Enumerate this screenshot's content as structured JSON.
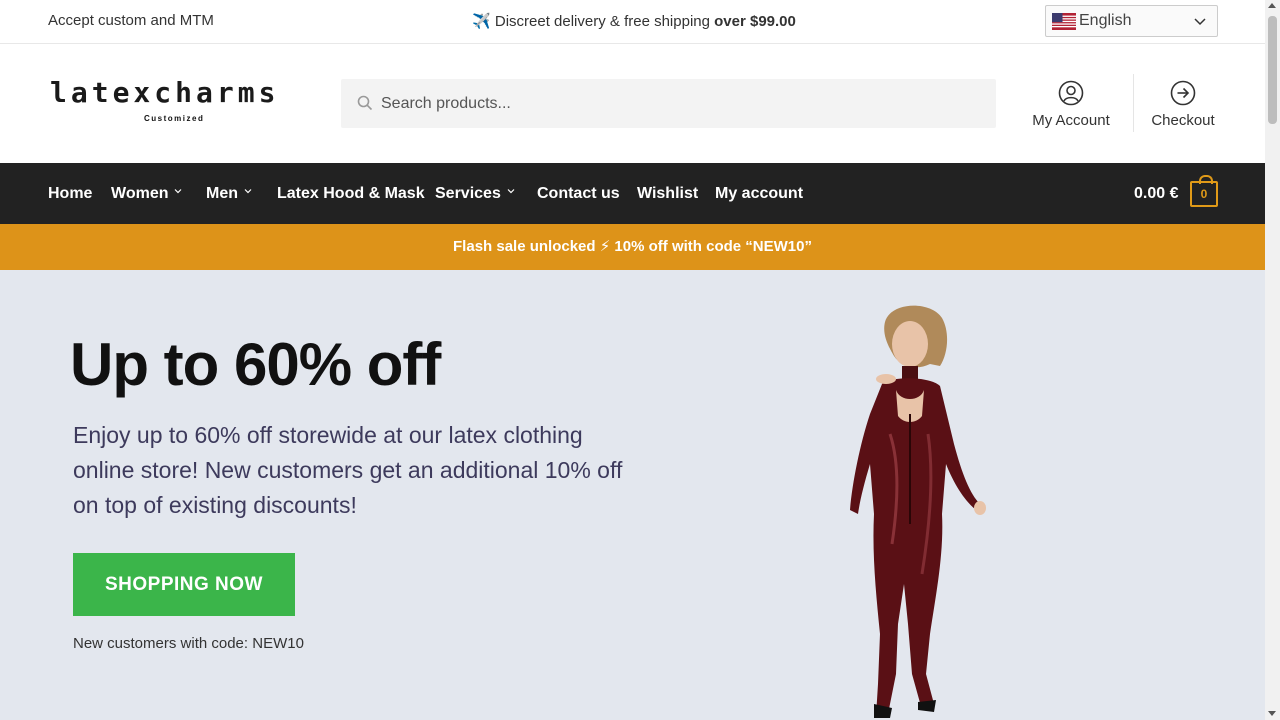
{
  "topbar": {
    "left_text": "Accept custom and MTM",
    "delivery_icon": "✈️",
    "delivery_text": "Discreet delivery & free shipping ",
    "delivery_bold": "over $99.00",
    "language": "English",
    "language_flag": "us-flag-icon"
  },
  "header": {
    "logo_text": "latexcharms",
    "logo_subtext": "Customized",
    "search_placeholder": "Search products...",
    "account_label": "My Account",
    "checkout_label": "Checkout"
  },
  "nav": {
    "items": [
      {
        "label": "Home",
        "has_caret": false
      },
      {
        "label": "Women",
        "has_caret": true
      },
      {
        "label": "Men",
        "has_caret": true
      },
      {
        "label": "Latex Hood & Mask",
        "has_caret": false
      },
      {
        "label": "Services",
        "has_caret": true
      },
      {
        "label": "Contact us",
        "has_caret": false
      },
      {
        "label": "Wishlist",
        "has_caret": false
      },
      {
        "label": "My account",
        "has_caret": false
      }
    ],
    "cart_total": "0.00 €",
    "cart_count": "0"
  },
  "flash": {
    "text": "Flash sale unlocked ⚡ 10% off with code “NEW10”"
  },
  "hero": {
    "title": "Up to 60% off",
    "description": "Enjoy up to 60% off storewide at our latex clothing online store! New customers get an additional 10% off on top of existing discounts!",
    "cta_label": "SHOPPING NOW",
    "note": "New customers with code: NEW10"
  },
  "colors": {
    "nav_bg": "#222222",
    "flash_bg": "#dd9319",
    "hero_bg": "#e3e7ee",
    "cta_bg": "#3bb54a",
    "accent": "#e09a18"
  }
}
